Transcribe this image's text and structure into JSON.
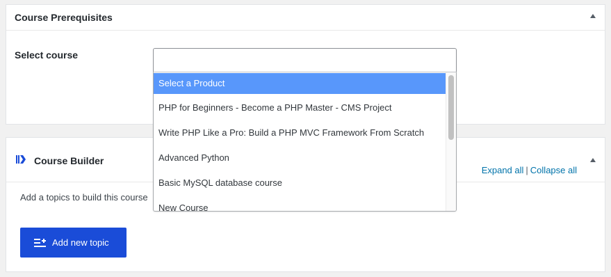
{
  "prerequisites": {
    "title": "Course Prerequisites",
    "field_label": "Select course",
    "select_value": "",
    "options": [
      "Select a Product",
      "PHP for Beginners - Become a PHP Master - CMS Project",
      "Write PHP Like a Pro: Build a PHP MVC Framework From Scratch",
      "Advanced Python",
      "Basic MySQL database course",
      "New Course"
    ],
    "highlighted_option": 0
  },
  "builder": {
    "title": "Course Builder",
    "expand_all": "Expand all",
    "separator": "|",
    "collapse_all": "Collapse all",
    "hint": "Add a topics to build this course",
    "add_topic_label": "Add new topic"
  },
  "colors": {
    "accent_button": "#1a4cd8",
    "highlight": "#5897fb",
    "link": "#0073aa"
  },
  "icons": {
    "collapse": "triangle-up-icon",
    "builder": "course-builder-icon",
    "add_topic": "add-list-icon"
  }
}
